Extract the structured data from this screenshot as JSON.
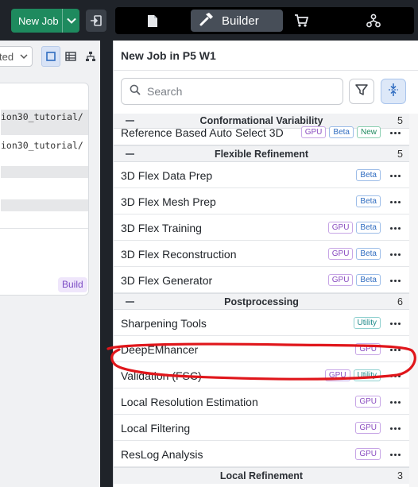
{
  "header": {
    "new_job_label": "New Job",
    "builder_label": "Builder",
    "tabs": [
      {
        "name": "document-icon"
      },
      {
        "name": "hammer-icon",
        "label_key": "builder"
      },
      {
        "name": "cart-icon"
      },
      {
        "name": "workflow-icon"
      }
    ]
  },
  "left": {
    "view_select_value": "ted",
    "path_lines": [
      "ion30_tutorial/",
      "ion30_tutorial/"
    ],
    "build_badge": "Build"
  },
  "panel": {
    "title": "New Job in P5 W1",
    "search_placeholder": "Search"
  },
  "sections": [
    {
      "title": "Conformational Variability",
      "count": "5",
      "jobs": [
        {
          "name": "Reference Based Auto Select 3D",
          "badges": [
            "GPU",
            "Beta",
            "New"
          ]
        }
      ]
    },
    {
      "title": "Flexible Refinement",
      "count": "5",
      "jobs": [
        {
          "name": "3D Flex Data Prep",
          "badges": [
            "Beta"
          ]
        },
        {
          "name": "3D Flex Mesh Prep",
          "badges": [
            "Beta"
          ]
        },
        {
          "name": "3D Flex Training",
          "badges": [
            "GPU",
            "Beta"
          ]
        },
        {
          "name": "3D Flex Reconstruction",
          "badges": [
            "GPU",
            "Beta"
          ]
        },
        {
          "name": "3D Flex Generator",
          "badges": [
            "GPU",
            "Beta"
          ]
        }
      ]
    },
    {
      "title": "Postprocessing",
      "count": "6",
      "jobs": [
        {
          "name": "Sharpening Tools",
          "badges": [
            "Utility"
          ]
        },
        {
          "name": "DeepEMhancer",
          "badges": [
            "GPU"
          ]
        },
        {
          "name": "Validation (FSC)",
          "badges": [
            "GPU",
            "Utility"
          ]
        },
        {
          "name": "Local Resolution Estimation",
          "badges": [
            "GPU"
          ]
        },
        {
          "name": "Local Filtering",
          "badges": [
            "GPU"
          ]
        },
        {
          "name": "ResLog Analysis",
          "badges": [
            "GPU"
          ]
        }
      ]
    }
  ],
  "partial_section": {
    "title": "Local Refinement",
    "count": "3"
  },
  "colors": {
    "accent_green": "#1e8a5e",
    "annotation_red": "#e0161b",
    "topbar_bg": "#1f2329"
  }
}
